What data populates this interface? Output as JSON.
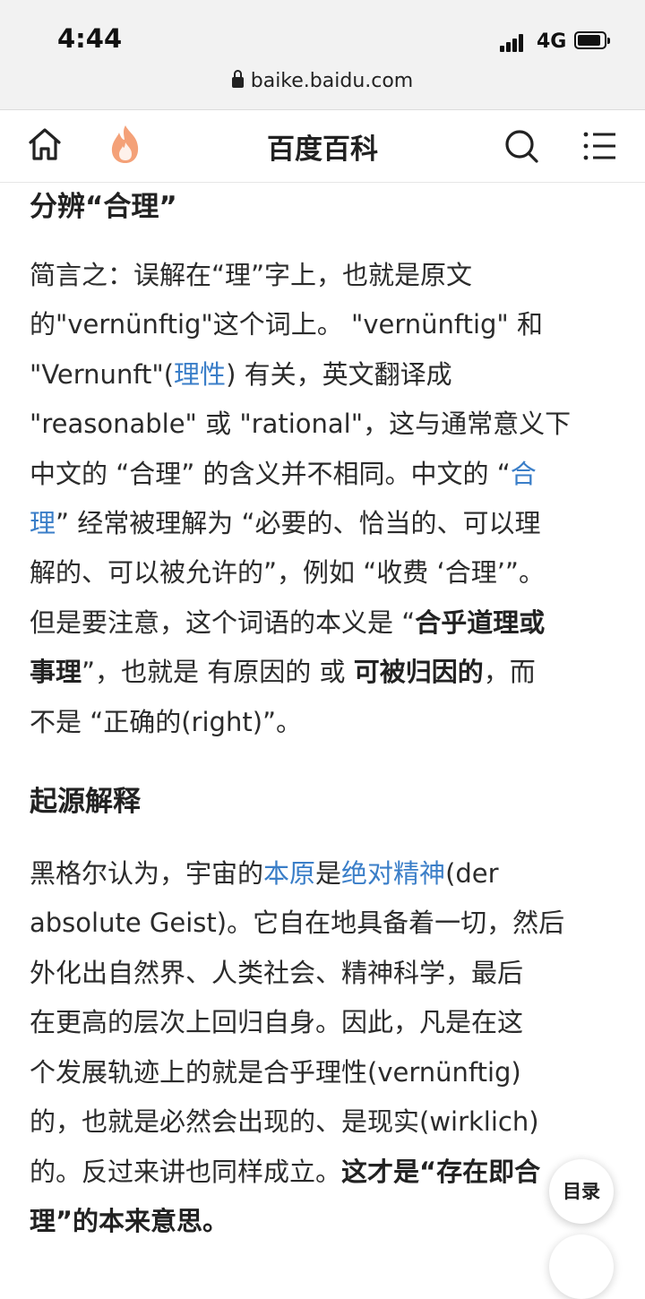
{
  "status": {
    "time": "4:44",
    "network": "4G"
  },
  "browser": {
    "url": "baike.baidu.com"
  },
  "nav": {
    "title": "百度百科"
  },
  "section1": {
    "heading": "分辨“合理”",
    "l1": "简言之：误解在“理”字上，也就是原文",
    "l2": "的\"vernünftig\"这个词上。 \"vernünftig\" 和",
    "l3a": "\"Vernunft\"(",
    "l3link": "理性",
    "l3b": ") 有关，英文翻译成",
    "l4": "\"reasonable\" 或 \"rational\"，这与通常意义下",
    "l5a": "中文的 “合理” 的含义并不相同。中文的 “",
    "l5link": "合",
    "l6link": "理",
    "l6b": "” 经常被理解为 “必要的、恰当的、可以理",
    "l7": "解的、可以被允许的”，例如 “收费 ‘合理’”。",
    "l8a": "但是要注意，这个词语的本义是 “",
    "l8bold": "合乎道理或",
    "l9bold1": "事理",
    "l9a": "”，也就是 有原因的 或 ",
    "l9bold2": "可被归因的",
    "l9b": "，而",
    "l10": "不是 “正确的(right)”。"
  },
  "section2": {
    "heading": "起源解释",
    "l1a": "黑格尔认为，宇宙的",
    "l1link1": "本原",
    "l1b": "是",
    "l1link2": "绝对精神",
    "l1c": "(der",
    "l2": "absolute Geist)。它自在地具备着一切，然后",
    "l3": "外化出自然界、人类社会、精神科学，最后",
    "l4": "在更高的层次上回归自身。因此，凡是在这",
    "l5": "个发展轨迹上的就是合乎理性(vernünftig)",
    "l6": "的，也就是必然会出现的、是现实(wirklich)",
    "l7a": "的。反过来讲也同样成立。",
    "l7bold": "这才是“存在即合",
    "l8bold": "理”的本来意思。"
  },
  "toc": {
    "label": "目录"
  },
  "colors": {
    "link": "#3a7ec8",
    "text": "#2b2b2b",
    "statusbar_bg": "#f2f2f2",
    "fire_icon": "#f4a178"
  }
}
